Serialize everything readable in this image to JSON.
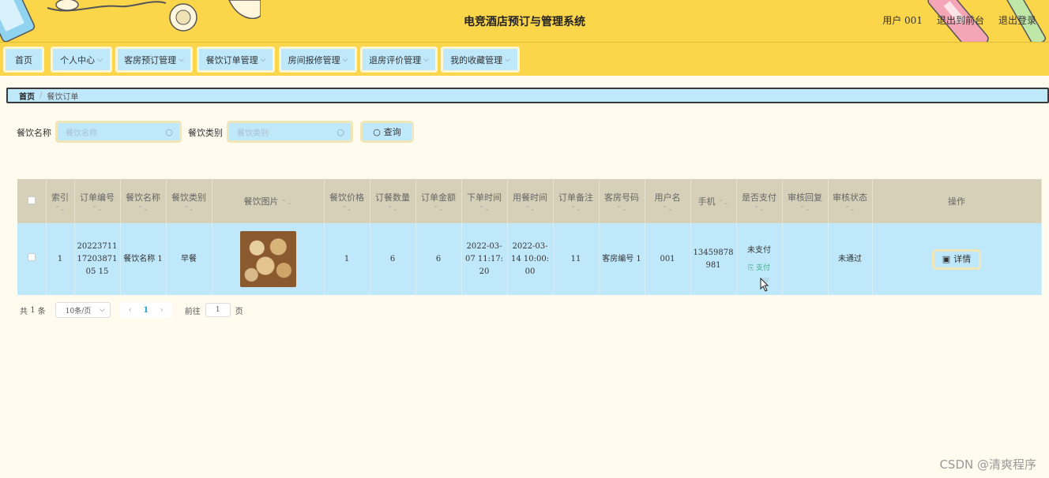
{
  "header": {
    "title": "电竞酒店预订与管理系统",
    "user_label": "用户 001",
    "to_front": "退出到前台",
    "logout": "退出登录"
  },
  "nav": [
    {
      "label": "首页",
      "has_dropdown": false
    },
    {
      "label": "个人中心",
      "has_dropdown": true
    },
    {
      "label": "客房预订管理",
      "has_dropdown": true
    },
    {
      "label": "餐饮订单管理",
      "has_dropdown": true
    },
    {
      "label": "房间报修管理",
      "has_dropdown": true
    },
    {
      "label": "退房评价管理",
      "has_dropdown": true
    },
    {
      "label": "我的收藏管理",
      "has_dropdown": true
    }
  ],
  "breadcrumb": {
    "home": "首页",
    "separator": "/",
    "current": "餐饮订单"
  },
  "search": {
    "name_label": "餐饮名称",
    "name_placeholder": "餐饮名称",
    "type_label": "餐饮类别",
    "type_placeholder": "餐饮类别",
    "query_button": "查询"
  },
  "table": {
    "headers": [
      "索引",
      "订单编号",
      "餐饮名称",
      "餐饮类别",
      "餐饮图片",
      "餐饮价格",
      "订餐数量",
      "订单金额",
      "下单时间",
      "用餐时间",
      "订单备注",
      "客房号码",
      "用户名",
      "手机",
      "是否支付",
      "审核回复",
      "审核状态",
      "操作"
    ],
    "rows": [
      {
        "index": "1",
        "order_no": "202237111720387105 15",
        "food_name": "餐饮名称 1",
        "food_type": "早餐",
        "price": "1",
        "quantity": "6",
        "amount": "6",
        "order_time": "2022-03-07 11:17:20",
        "meal_time": "2022-03-14 10:00:00",
        "remark": "11",
        "room_no": "客房编号 1",
        "username": "001",
        "phone": "13459878981",
        "paid": "未支付",
        "pay_action": "支付",
        "review_reply": "",
        "review_status": "未通过",
        "detail_button": "详情"
      }
    ]
  },
  "pagination": {
    "total_prefix": "共",
    "total": "1",
    "total_suffix": "条",
    "page_size": "10条/页",
    "current_page": "1",
    "goto_prefix": "前往",
    "goto_value": "1",
    "goto_suffix": "页"
  },
  "watermark": "CSDN @清爽程序",
  "colors": {
    "header_bg": "#fcd64a",
    "panel_bg": "#bfe8fb",
    "page_bg": "#fffbef",
    "table_head_bg": "#d6d0b8"
  }
}
